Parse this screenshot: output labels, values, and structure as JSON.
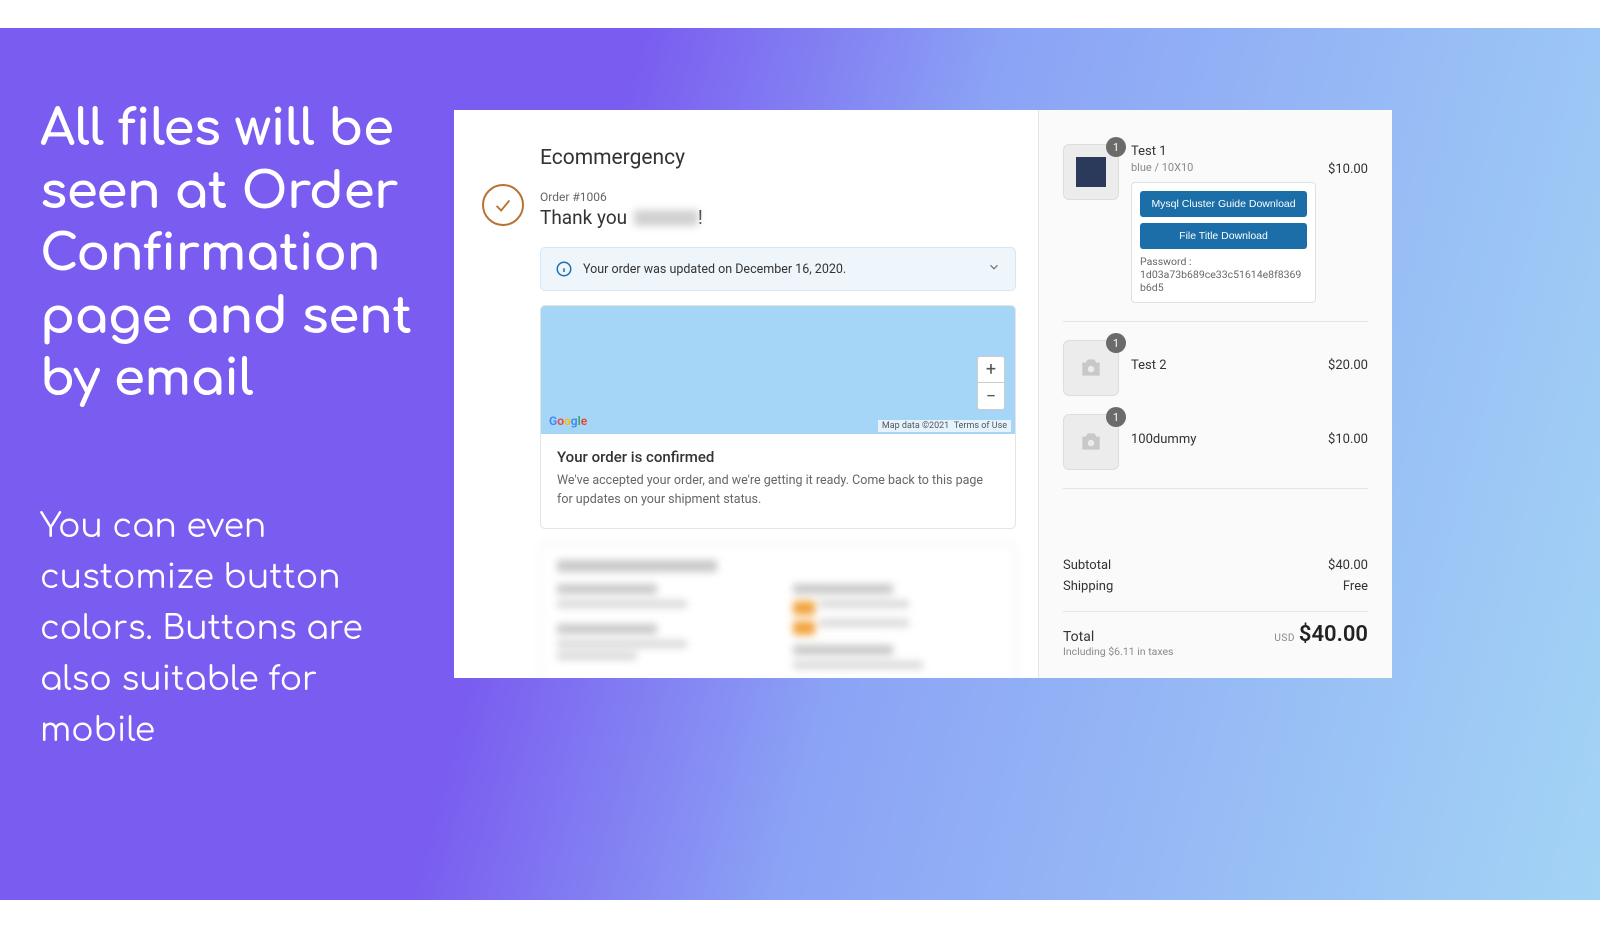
{
  "promo": {
    "headline": "All files will be seen at Order Confirmation page and sent by email",
    "sub": "You can even customize button colors. Buttons are also suitable for mobile"
  },
  "checkout": {
    "store_name": "Ecommergency",
    "order_label": "Order #1006",
    "thank_you": "Thank you",
    "notice_text": "Your order was updated on December 16, 2020.",
    "map": {
      "attr_data": "Map data ©2021",
      "attr_terms": "Terms of Use"
    },
    "confirmed": {
      "title": "Your order is confirmed",
      "body": "We've accepted your order, and we're getting it ready. Come back to this page for updates on your shipment status."
    }
  },
  "items": [
    {
      "name": "Test 1",
      "variant": "blue / 10X10",
      "qty": "1",
      "price": "$10.00",
      "thumb_type": "swatch",
      "downloads": [
        {
          "label": "Mysql Cluster Guide Download"
        },
        {
          "label": "File Title Download"
        }
      ],
      "password_label": "Password :",
      "password_value": "1d03a73b689ce33c51614e8f8369b6d5"
    },
    {
      "name": "Test 2",
      "variant": "",
      "qty": "1",
      "price": "$20.00",
      "thumb_type": "placeholder"
    },
    {
      "name": "100dummy",
      "variant": "",
      "qty": "1",
      "price": "$10.00",
      "thumb_type": "placeholder"
    }
  ],
  "summary": {
    "subtotal_label": "Subtotal",
    "subtotal_value": "$40.00",
    "shipping_label": "Shipping",
    "shipping_value": "Free",
    "total_label": "Total",
    "tax_note": "Including $6.11 in taxes",
    "currency": "USD",
    "total_value": "$40.00"
  }
}
